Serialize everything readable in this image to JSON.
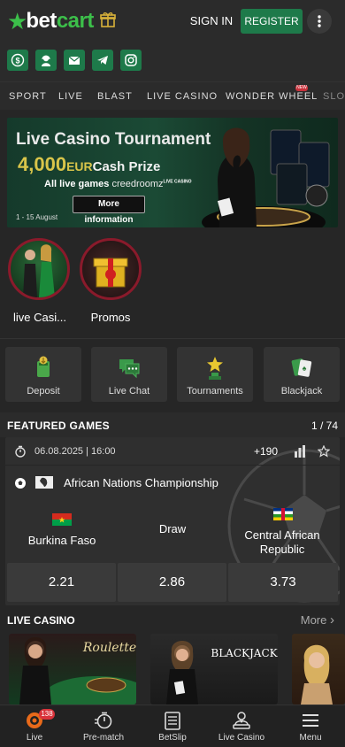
{
  "header": {
    "logo_part1": "bet",
    "logo_part2": "cart",
    "signin_label": "SIGN IN",
    "register_label": "REGISTER",
    "socials": [
      "dollar-icon",
      "support-agent-icon",
      "mail-icon",
      "telegram-icon",
      "instagram-icon"
    ]
  },
  "sport_nav": {
    "items": [
      "SPORT",
      "LIVE",
      "BLAST",
      "LIVE CASINO",
      "WONDER WHEEL",
      "SLO"
    ],
    "new_badge": "NEW"
  },
  "banner": {
    "title": "Live Casino Tournament",
    "prize_amount": "4,000",
    "prize_currency": "EUR",
    "prize_text": "Cash Prize",
    "all_live": "All live games",
    "provider": "creedroomz",
    "provider_sub": "LIVE CASINO",
    "more_info": "More information",
    "dates": "1 - 15 August"
  },
  "promo_circles": [
    {
      "label": "live Casi..."
    },
    {
      "label": "Promos"
    }
  ],
  "quick_tiles": [
    {
      "label": "Deposit",
      "icon": "deposit-icon"
    },
    {
      "label": "Live Chat",
      "icon": "chat-icon"
    },
    {
      "label": "Tournaments",
      "icon": "trophy-icon"
    },
    {
      "label": "Blackjack",
      "icon": "cards-icon"
    }
  ],
  "featured": {
    "title": "FEATURED GAMES",
    "count": "1 / 74",
    "match": {
      "datetime": "06.08.2025 | 16:00",
      "markets": "+190",
      "league": "African Nations Championship",
      "home": "Burkina Faso",
      "draw": "Draw",
      "away": "Central African Republic",
      "odds": [
        "2.21",
        "2.86",
        "3.73"
      ]
    }
  },
  "live_casino": {
    "title": "LIVE CASINO",
    "more": "More",
    "cards": [
      "Roulette",
      "BLACKJACK",
      ""
    ]
  },
  "bottom_bar": {
    "items": [
      {
        "label": "Live",
        "icon": "live-icon",
        "badge": "138"
      },
      {
        "label": "Pre-match",
        "icon": "stopwatch-icon"
      },
      {
        "label": "BetSlip",
        "icon": "betslip-icon"
      },
      {
        "label": "Live Casino",
        "icon": "dealer-icon"
      },
      {
        "label": "Menu",
        "icon": "menu-icon"
      }
    ]
  },
  "colors": {
    "brand_green": "#1e7a4a",
    "logo_green": "#3cbf4a",
    "gold": "#d9c54a",
    "background": "#262626",
    "badge_red": "#d9333b"
  }
}
